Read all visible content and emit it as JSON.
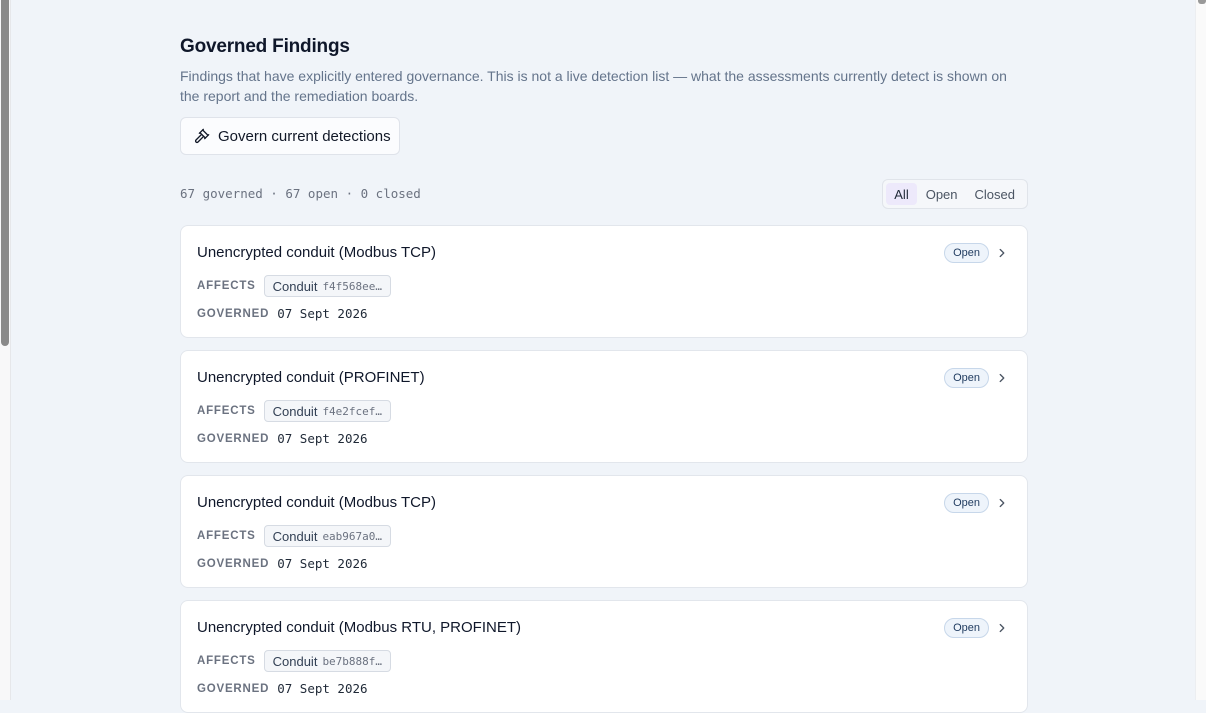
{
  "page": {
    "title": "Governed Findings",
    "description": "Findings that have explicitly entered governance. This is not a live detection list — what the assessments currently detect is shown on the report and the remediation boards.",
    "govern_button_label": "Govern current detections",
    "summary": "67 governed · 67 open · 0 closed"
  },
  "filters": [
    {
      "label": "All",
      "active": true
    },
    {
      "label": "Open",
      "active": false
    },
    {
      "label": "Closed",
      "active": false
    }
  ],
  "labels": {
    "affects": "AFFECTS",
    "governed": "GOVERNED"
  },
  "findings": [
    {
      "title": "Unencrypted conduit (Modbus TCP)",
      "status": "Open",
      "chip_label": "Conduit",
      "chip_id": "f4f568ee…",
      "governed_date": "07 Sept 2026"
    },
    {
      "title": "Unencrypted conduit (PROFINET)",
      "status": "Open",
      "chip_label": "Conduit",
      "chip_id": "f4e2fcef…",
      "governed_date": "07 Sept 2026"
    },
    {
      "title": "Unencrypted conduit (Modbus TCP)",
      "status": "Open",
      "chip_label": "Conduit",
      "chip_id": "eab967a0…",
      "governed_date": "07 Sept 2026"
    },
    {
      "title": "Unencrypted conduit (Modbus RTU, PROFINET)",
      "status": "Open",
      "chip_label": "Conduit",
      "chip_id": "be7b888f…",
      "governed_date": "07 Sept 2026"
    }
  ],
  "icons": {
    "govern": "gavel-icon",
    "row_chevron": "chevron-right-icon"
  },
  "colors": {
    "background": "#f0f4f9",
    "card": "#ffffff",
    "active_filter": "#ede9fb",
    "badge_bg": "#eef4fb"
  }
}
